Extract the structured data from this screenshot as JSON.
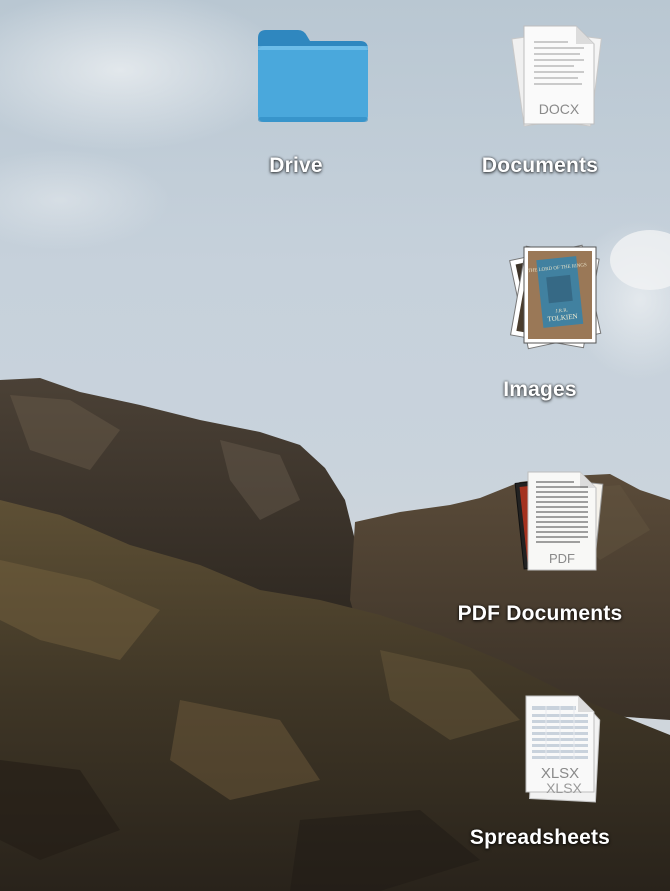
{
  "desktop": {
    "icons": [
      {
        "label": "Drive",
        "icon": "folder-icon",
        "color": "#4aa8dc"
      },
      {
        "label": "Documents",
        "icon": "docx-stack-icon",
        "badge": "DOCX"
      },
      {
        "label": "Images",
        "icon": "image-stack-icon",
        "cover_lines": [
          "THE LORD OF THE RINGS",
          "J.R.R.",
          "TOLKIEN"
        ]
      },
      {
        "label": "PDF Documents",
        "icon": "pdf-stack-icon",
        "badge": "PDF"
      },
      {
        "label": "Spreadsheets",
        "icon": "xlsx-stack-icon",
        "badge": "XLSX"
      }
    ]
  }
}
